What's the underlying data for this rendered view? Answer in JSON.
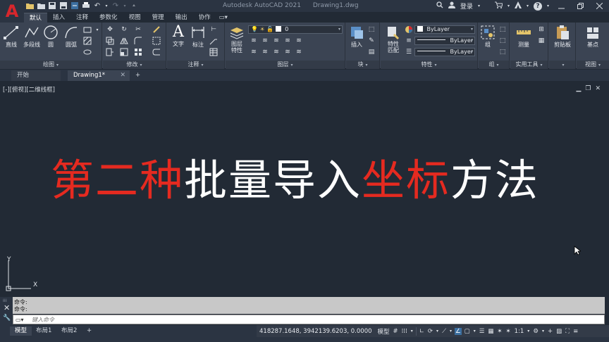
{
  "window": {
    "app_title": "Autodesk AutoCAD 2021",
    "document_title": "Drawing1.dwg",
    "login_label": "登录",
    "logo_letter": "A"
  },
  "ribbon_tabs": [
    "默认",
    "插入",
    "注释",
    "参数化",
    "视图",
    "管理",
    "输出",
    "协作"
  ],
  "ribbon_active_tab": "默认",
  "panels": {
    "draw": {
      "title": "绘图",
      "tools": [
        "直线",
        "多段线",
        "圆",
        "圆弧"
      ]
    },
    "modify": {
      "title": "修改"
    },
    "annotation": {
      "title": "注释",
      "tools": [
        "文字",
        "标注"
      ]
    },
    "layers": {
      "title": "图层",
      "layer_properties_label": "图层\n特性",
      "current_layer": "0"
    },
    "block": {
      "title": "块",
      "insert_label": "插入"
    },
    "properties": {
      "title": "特性",
      "match_label": "特性\n匹配",
      "color": "ByLayer",
      "linetype": "ByLayer",
      "lineweight": "ByLayer"
    },
    "groups": {
      "title": "组",
      "group_label": "组"
    },
    "utilities": {
      "title": "实用工具",
      "measure_label": "测量"
    },
    "clipboard": {
      "title": "剪贴板",
      "label": "剪贴板"
    },
    "view": {
      "title": "视图",
      "base_label": "基点"
    }
  },
  "file_tabs": {
    "start": "开始",
    "drawing": "Drawing1*",
    "new": "+"
  },
  "viewport": {
    "label": "[-][俯视][二维线框]",
    "ucs_x": "X",
    "ucs_y": "Y"
  },
  "headline": {
    "red_1": "第二种",
    "white_1": "批量导入",
    "red_2": "坐标",
    "white_2": "方法"
  },
  "command": {
    "history": [
      "命令:",
      "命令:"
    ],
    "placeholder": "键入命令"
  },
  "layout_tabs": [
    "模型",
    "布局1",
    "布局2",
    "+"
  ],
  "status": {
    "coordinates": "418287.1648, 3942139.6203, 0.0000",
    "model_label": "模型",
    "scale": "1:1"
  },
  "colors": {
    "accent_red": "#e52a20",
    "background": "#222a35",
    "ribbon": "#3b4453"
  }
}
